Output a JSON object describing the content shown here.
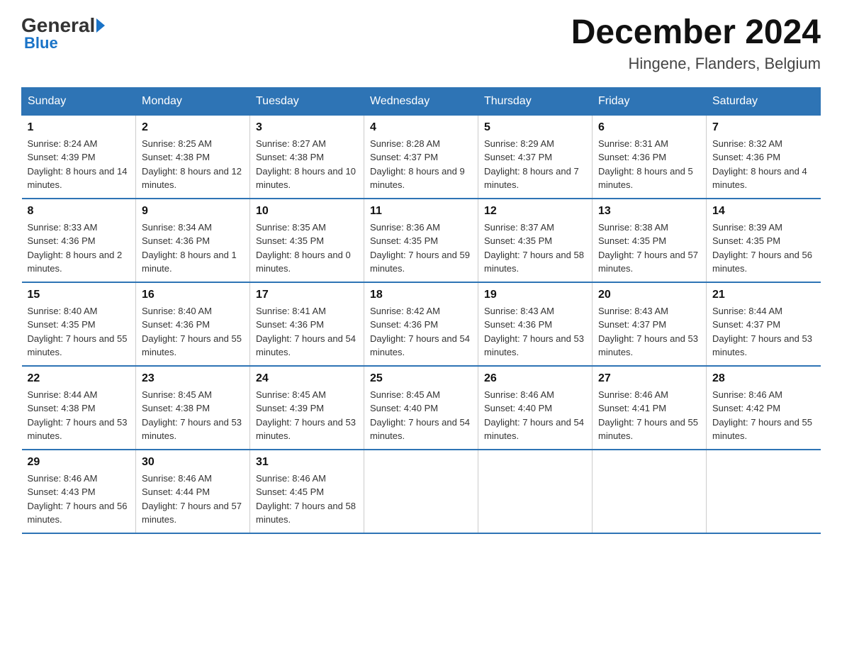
{
  "header": {
    "logo_general": "General",
    "logo_blue": "Blue",
    "title": "December 2024",
    "subtitle": "Hingene, Flanders, Belgium"
  },
  "weekdays": [
    "Sunday",
    "Monday",
    "Tuesday",
    "Wednesday",
    "Thursday",
    "Friday",
    "Saturday"
  ],
  "weeks": [
    [
      {
        "day": "1",
        "sunrise": "8:24 AM",
        "sunset": "4:39 PM",
        "daylight": "8 hours and 14 minutes."
      },
      {
        "day": "2",
        "sunrise": "8:25 AM",
        "sunset": "4:38 PM",
        "daylight": "8 hours and 12 minutes."
      },
      {
        "day": "3",
        "sunrise": "8:27 AM",
        "sunset": "4:38 PM",
        "daylight": "8 hours and 10 minutes."
      },
      {
        "day": "4",
        "sunrise": "8:28 AM",
        "sunset": "4:37 PM",
        "daylight": "8 hours and 9 minutes."
      },
      {
        "day": "5",
        "sunrise": "8:29 AM",
        "sunset": "4:37 PM",
        "daylight": "8 hours and 7 minutes."
      },
      {
        "day": "6",
        "sunrise": "8:31 AM",
        "sunset": "4:36 PM",
        "daylight": "8 hours and 5 minutes."
      },
      {
        "day": "7",
        "sunrise": "8:32 AM",
        "sunset": "4:36 PM",
        "daylight": "8 hours and 4 minutes."
      }
    ],
    [
      {
        "day": "8",
        "sunrise": "8:33 AM",
        "sunset": "4:36 PM",
        "daylight": "8 hours and 2 minutes."
      },
      {
        "day": "9",
        "sunrise": "8:34 AM",
        "sunset": "4:36 PM",
        "daylight": "8 hours and 1 minute."
      },
      {
        "day": "10",
        "sunrise": "8:35 AM",
        "sunset": "4:35 PM",
        "daylight": "8 hours and 0 minutes."
      },
      {
        "day": "11",
        "sunrise": "8:36 AM",
        "sunset": "4:35 PM",
        "daylight": "7 hours and 59 minutes."
      },
      {
        "day": "12",
        "sunrise": "8:37 AM",
        "sunset": "4:35 PM",
        "daylight": "7 hours and 58 minutes."
      },
      {
        "day": "13",
        "sunrise": "8:38 AM",
        "sunset": "4:35 PM",
        "daylight": "7 hours and 57 minutes."
      },
      {
        "day": "14",
        "sunrise": "8:39 AM",
        "sunset": "4:35 PM",
        "daylight": "7 hours and 56 minutes."
      }
    ],
    [
      {
        "day": "15",
        "sunrise": "8:40 AM",
        "sunset": "4:35 PM",
        "daylight": "7 hours and 55 minutes."
      },
      {
        "day": "16",
        "sunrise": "8:40 AM",
        "sunset": "4:36 PM",
        "daylight": "7 hours and 55 minutes."
      },
      {
        "day": "17",
        "sunrise": "8:41 AM",
        "sunset": "4:36 PM",
        "daylight": "7 hours and 54 minutes."
      },
      {
        "day": "18",
        "sunrise": "8:42 AM",
        "sunset": "4:36 PM",
        "daylight": "7 hours and 54 minutes."
      },
      {
        "day": "19",
        "sunrise": "8:43 AM",
        "sunset": "4:36 PM",
        "daylight": "7 hours and 53 minutes."
      },
      {
        "day": "20",
        "sunrise": "8:43 AM",
        "sunset": "4:37 PM",
        "daylight": "7 hours and 53 minutes."
      },
      {
        "day": "21",
        "sunrise": "8:44 AM",
        "sunset": "4:37 PM",
        "daylight": "7 hours and 53 minutes."
      }
    ],
    [
      {
        "day": "22",
        "sunrise": "8:44 AM",
        "sunset": "4:38 PM",
        "daylight": "7 hours and 53 minutes."
      },
      {
        "day": "23",
        "sunrise": "8:45 AM",
        "sunset": "4:38 PM",
        "daylight": "7 hours and 53 minutes."
      },
      {
        "day": "24",
        "sunrise": "8:45 AM",
        "sunset": "4:39 PM",
        "daylight": "7 hours and 53 minutes."
      },
      {
        "day": "25",
        "sunrise": "8:45 AM",
        "sunset": "4:40 PM",
        "daylight": "7 hours and 54 minutes."
      },
      {
        "day": "26",
        "sunrise": "8:46 AM",
        "sunset": "4:40 PM",
        "daylight": "7 hours and 54 minutes."
      },
      {
        "day": "27",
        "sunrise": "8:46 AM",
        "sunset": "4:41 PM",
        "daylight": "7 hours and 55 minutes."
      },
      {
        "day": "28",
        "sunrise": "8:46 AM",
        "sunset": "4:42 PM",
        "daylight": "7 hours and 55 minutes."
      }
    ],
    [
      {
        "day": "29",
        "sunrise": "8:46 AM",
        "sunset": "4:43 PM",
        "daylight": "7 hours and 56 minutes."
      },
      {
        "day": "30",
        "sunrise": "8:46 AM",
        "sunset": "4:44 PM",
        "daylight": "7 hours and 57 minutes."
      },
      {
        "day": "31",
        "sunrise": "8:46 AM",
        "sunset": "4:45 PM",
        "daylight": "7 hours and 58 minutes."
      },
      null,
      null,
      null,
      null
    ]
  ],
  "labels": {
    "sunrise_prefix": "Sunrise: ",
    "sunset_prefix": "Sunset: ",
    "daylight_prefix": "Daylight: "
  }
}
